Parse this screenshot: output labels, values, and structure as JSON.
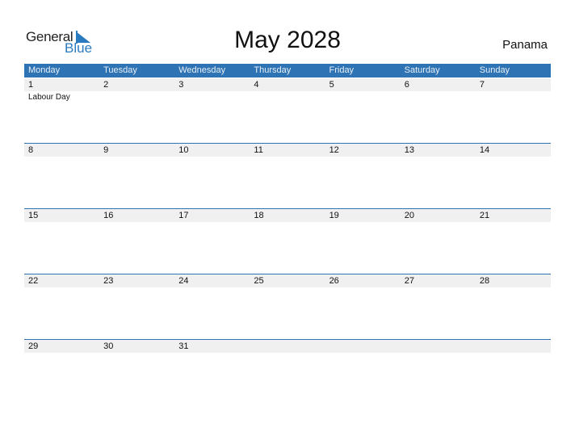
{
  "logo": {
    "line1": "General",
    "line2": "Blue"
  },
  "title": "May 2028",
  "country": "Panama",
  "colors": {
    "header_bg": "#2e73b4",
    "accent": "#2a7ac0",
    "strip_bg": "#f0f0f0"
  },
  "weekdays": [
    "Monday",
    "Tuesday",
    "Wednesday",
    "Thursday",
    "Friday",
    "Saturday",
    "Sunday"
  ],
  "weeks": [
    {
      "days": [
        {
          "day": "1",
          "event": "Labour Day"
        },
        {
          "day": "2",
          "event": ""
        },
        {
          "day": "3",
          "event": ""
        },
        {
          "day": "4",
          "event": ""
        },
        {
          "day": "5",
          "event": ""
        },
        {
          "day": "6",
          "event": ""
        },
        {
          "day": "7",
          "event": ""
        }
      ]
    },
    {
      "days": [
        {
          "day": "8",
          "event": ""
        },
        {
          "day": "9",
          "event": ""
        },
        {
          "day": "10",
          "event": ""
        },
        {
          "day": "11",
          "event": ""
        },
        {
          "day": "12",
          "event": ""
        },
        {
          "day": "13",
          "event": ""
        },
        {
          "day": "14",
          "event": ""
        }
      ]
    },
    {
      "days": [
        {
          "day": "15",
          "event": ""
        },
        {
          "day": "16",
          "event": ""
        },
        {
          "day": "17",
          "event": ""
        },
        {
          "day": "18",
          "event": ""
        },
        {
          "day": "19",
          "event": ""
        },
        {
          "day": "20",
          "event": ""
        },
        {
          "day": "21",
          "event": ""
        }
      ]
    },
    {
      "days": [
        {
          "day": "22",
          "event": ""
        },
        {
          "day": "23",
          "event": ""
        },
        {
          "day": "24",
          "event": ""
        },
        {
          "day": "25",
          "event": ""
        },
        {
          "day": "26",
          "event": ""
        },
        {
          "day": "27",
          "event": ""
        },
        {
          "day": "28",
          "event": ""
        }
      ]
    },
    {
      "days": [
        {
          "day": "29",
          "event": ""
        },
        {
          "day": "30",
          "event": ""
        },
        {
          "day": "31",
          "event": ""
        },
        {
          "day": "",
          "event": ""
        },
        {
          "day": "",
          "event": ""
        },
        {
          "day": "",
          "event": ""
        },
        {
          "day": "",
          "event": ""
        }
      ]
    }
  ]
}
